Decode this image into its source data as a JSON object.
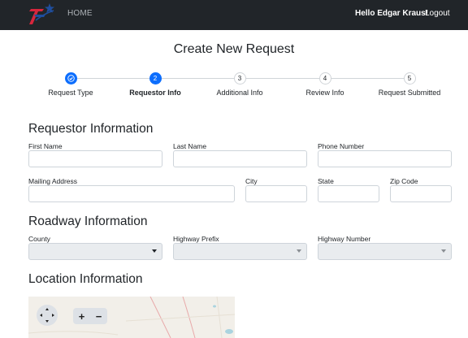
{
  "nav": {
    "home_label": "HOME",
    "greeting": "Hello Edgar Kraus!",
    "logout_label": "Logout"
  },
  "page": {
    "title": "Create New Request"
  },
  "stepper": {
    "steps": [
      {
        "number": "",
        "label": "Request Type",
        "state": "done"
      },
      {
        "number": "2",
        "label": "Requestor Info",
        "state": "active"
      },
      {
        "number": "3",
        "label": "Additional Info",
        "state": "pending"
      },
      {
        "number": "4",
        "label": "Review Info",
        "state": "pending"
      },
      {
        "number": "5",
        "label": "Request Submitted",
        "state": "pending"
      }
    ]
  },
  "requestor": {
    "title": "Requestor Information",
    "first_name_label": "First Name",
    "last_name_label": "Last Name",
    "phone_label": "Phone Number",
    "mailing_address_label": "Mailing Address",
    "city_label": "City",
    "state_label": "State",
    "zip_label": "Zip Code"
  },
  "roadway": {
    "title": "Roadway Information",
    "county_label": "County",
    "highway_prefix_label": "Highway Prefix",
    "highway_number_label": "Highway Number"
  },
  "location": {
    "title": "Location Information",
    "zoom_in": "+",
    "zoom_out": "−"
  },
  "colors": {
    "navbar": "#212529",
    "primary": "#0d6efd",
    "logo_red": "#d7263d",
    "logo_blue": "#1f4e9d"
  },
  "icons": {
    "logo": "txdot-logo",
    "step_done": "check-icon",
    "map_pan": "pan-arrows-icon"
  }
}
